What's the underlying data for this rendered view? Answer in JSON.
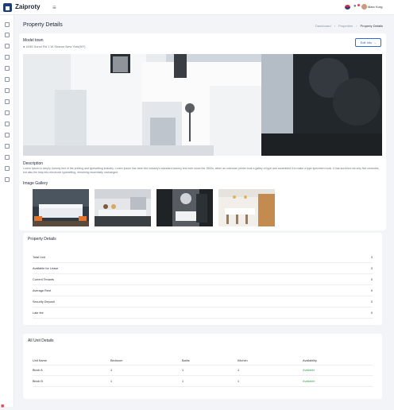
{
  "app": {
    "name": "Zaiproty",
    "user_name": "Marc Kurg"
  },
  "header": {
    "page_title": "Property Details",
    "breadcrumbs": [
      "Dashboard",
      "Properties",
      "Property Details"
    ]
  },
  "property": {
    "name": "Model town",
    "address": "4035 Sonol Rd 1 W Sharon New York(NY)",
    "edit_label": "Edit Info"
  },
  "description": {
    "title": "Description",
    "text": "Lorem Ipsum is simply dummy text of the printing and typesetting industry. Lorem Ipsum has been the industry's standard dummy text ever since the 1500s, when an unknown printer took a galley of type and scrambled it to make a type specimen book. It has survived not only five centuries, but also the leap into electronic typesetting, remaining essentially unchanged."
  },
  "gallery": {
    "title": "Image Gallery",
    "images": [
      "bedroom",
      "kitchen",
      "bathroom",
      "dining-kitchen"
    ]
  },
  "property_details": {
    "title": "Property Details",
    "rows": [
      {
        "label": "Total Unit",
        "value": "3"
      },
      {
        "label": "Available for Lease",
        "value": "3"
      },
      {
        "label": "Current Tenants",
        "value": "0"
      },
      {
        "label": "Average Rent",
        "value": "0"
      },
      {
        "label": "Security Deposit",
        "value": "0"
      },
      {
        "label": "Late fee",
        "value": "0"
      }
    ]
  },
  "units": {
    "title": "All Unit Details",
    "columns": [
      "Unit Name",
      "Bedroom",
      "Baths",
      "Kitchen",
      "Availability"
    ],
    "rows": [
      {
        "name": "Block A",
        "bedroom": "1",
        "baths": "1",
        "kitchen": "1",
        "availability": "Available"
      },
      {
        "name": "Block B",
        "bedroom": "1",
        "baths": "1",
        "kitchen": "1",
        "availability": "Available"
      }
    ]
  },
  "colors": {
    "brand": "#1d3d74",
    "accent": "#2d6ad6",
    "available": "#3aa757"
  }
}
